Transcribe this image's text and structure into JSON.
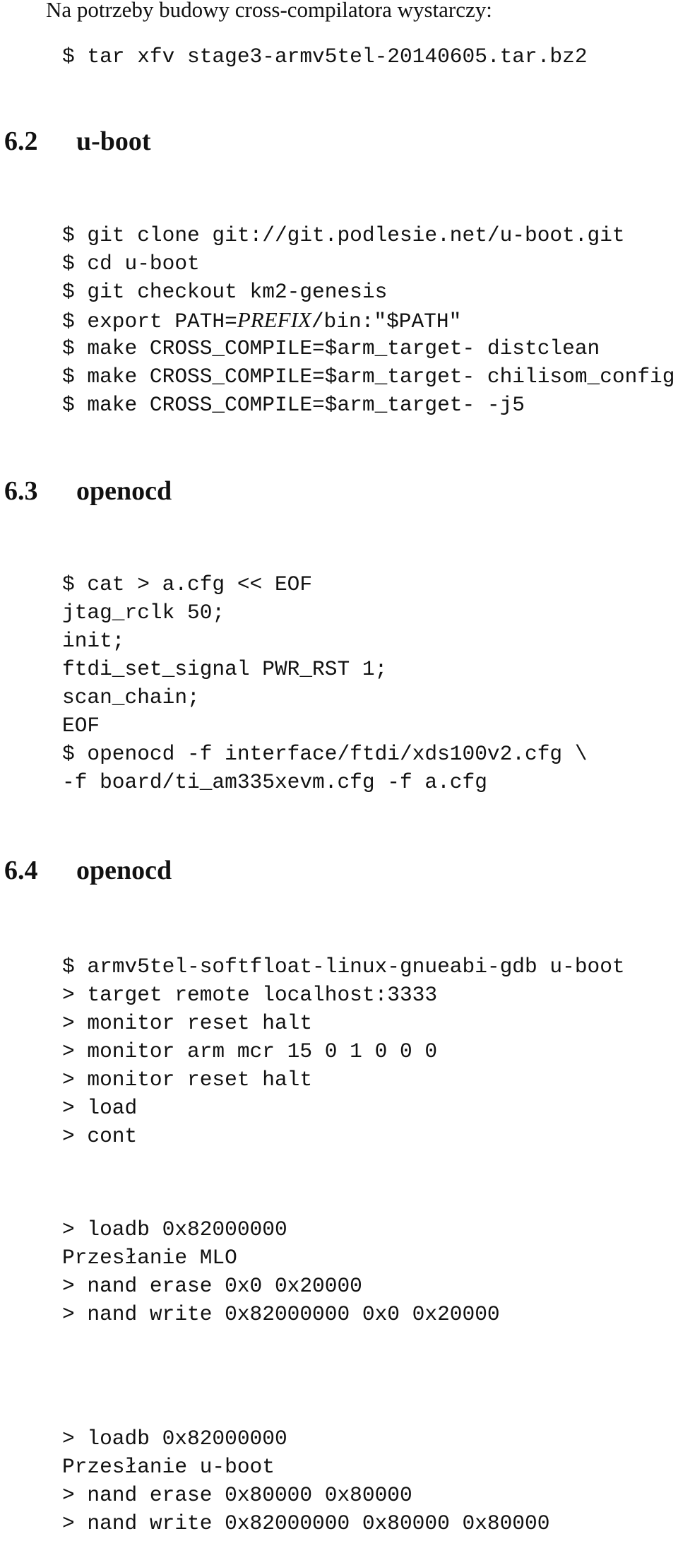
{
  "intro": {
    "text": "Na potrzeby budowy cross-compilatora wystarczy:",
    "command": "$ tar xfv stage3-armv5tel-20140605.tar.bz2"
  },
  "sections": [
    {
      "number": "6.2",
      "title": "u-boot",
      "code": [
        "$ git clone git://git.podlesie.net/u-boot.git",
        "$ cd u-boot",
        "$ git checkout km2-genesis",
        {
          "before": "$ export PATH=",
          "math": "PREFIX",
          "after": "/bin:\"$PATH\""
        },
        "$ make CROSS_COMPILE=$arm_target- distclean",
        "$ make CROSS_COMPILE=$arm_target- chilisom_config",
        "$ make CROSS_COMPILE=$arm_target- -j5"
      ]
    },
    {
      "number": "6.3",
      "title": "openocd",
      "code": [
        "$ cat > a.cfg << EOF",
        "jtag_rclk 50;",
        "init;",
        "ftdi_set_signal PWR_RST 1;",
        "scan_chain;",
        "EOF",
        "$ openocd -f interface/ftdi/xds100v2.cfg \\",
        "-f board/ti_am335xevm.cfg -f a.cfg"
      ]
    },
    {
      "number": "6.4",
      "title": "openocd",
      "code": [
        "$ armv5tel-softfloat-linux-gnueabi-gdb u-boot",
        "> target remote localhost:3333",
        "> monitor reset halt",
        "> monitor arm mcr 15 0 1 0 0 0",
        "> monitor reset halt",
        "> load",
        "> cont"
      ],
      "code_mlo": [
        "> loadb 0x82000000",
        "Przesłanie MLO",
        "> nand erase 0x0 0x20000",
        "> nand write 0x82000000 0x0 0x20000"
      ],
      "code_uboot": [
        "> loadb 0x82000000",
        "Przesłanie u-boot",
        "> nand erase 0x80000 0x80000",
        "> nand write 0x82000000 0x80000 0x80000"
      ]
    }
  ]
}
